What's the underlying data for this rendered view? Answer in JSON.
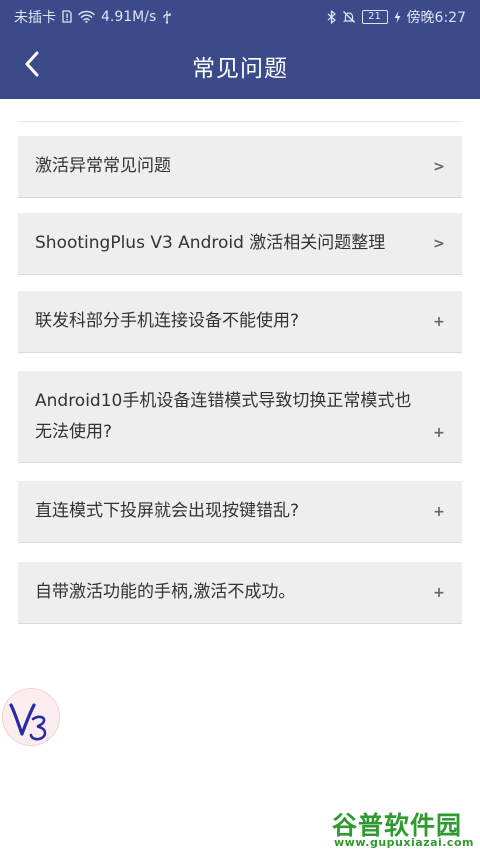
{
  "status_bar": {
    "carrier": "未插卡",
    "speed": "4.91M/s",
    "battery": "21",
    "time": "傍晚6:27"
  },
  "header": {
    "title": "常见问题"
  },
  "faq": [
    {
      "text": "激活异常常见问题",
      "mark": ">"
    },
    {
      "text": "ShootingPlus V3 Android 激活相关问题整理",
      "mark": ">"
    },
    {
      "text": "联发科部分手机连接设备不能使用?",
      "mark": "+"
    },
    {
      "text": "Android10手机设备连错模式导致切换正常模式也无法使用?",
      "mark": "+"
    },
    {
      "text": "直连模式下投屏就会出现按键错乱?",
      "mark": "+"
    },
    {
      "text": "自带激活功能的手柄,激活不成功。",
      "mark": "+"
    }
  ],
  "watermark": {
    "title": "谷普软件园",
    "url": "www.gupuxiazai.com"
  },
  "colors": {
    "primary": "#3a4a8a",
    "item_bg": "#eeeeee",
    "text": "#333333",
    "watermark": "#2f9a2f"
  }
}
